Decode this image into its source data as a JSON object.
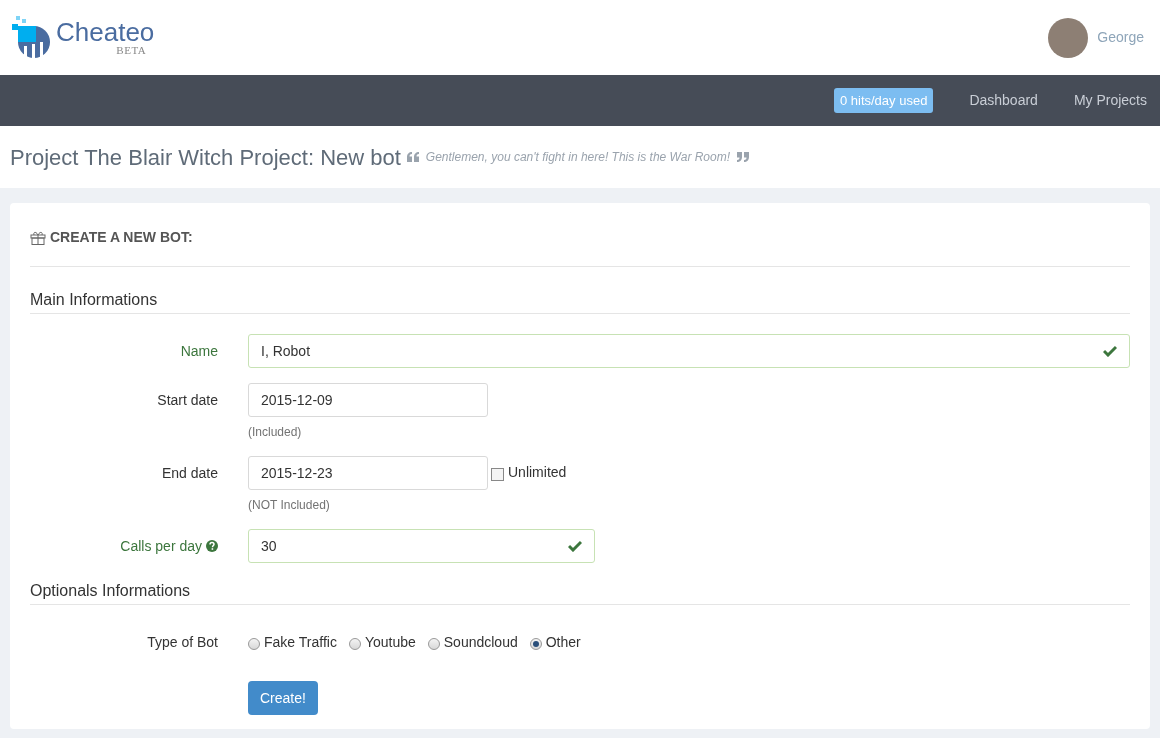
{
  "header": {
    "logo": {
      "name": "Cheateo",
      "tag": "BETA"
    },
    "user": {
      "name": "George"
    }
  },
  "nav": {
    "badge": "0 hits/day used",
    "links": [
      {
        "label": "Dashboard"
      },
      {
        "label": "My Projects"
      }
    ]
  },
  "page": {
    "title": "Project The Blair Witch Project: New bot",
    "quote": "Gentlemen, you can't fight in here! This is the War Room!"
  },
  "card": {
    "title": "CREATE A NEW BOT:",
    "sections": [
      {
        "heading": "Main Informations",
        "fields": [
          {
            "kind": "text",
            "label": "Name",
            "value": "I, Robot",
            "valid": true
          },
          {
            "kind": "date",
            "label": "Start date",
            "value": "2015-12-09",
            "valid": false,
            "help": "(Included)"
          },
          {
            "kind": "date",
            "label": "End date",
            "value": "2015-12-23",
            "valid": false,
            "help": "(NOT Included)",
            "checkbox": {
              "label": "Unlimited",
              "checked": false
            }
          },
          {
            "kind": "number",
            "label": "Calls per day",
            "value": "30",
            "valid": true,
            "info": true
          }
        ]
      },
      {
        "heading": "Optionals Informations",
        "fields": [
          {
            "kind": "radio",
            "label": "Type of Bot",
            "options": [
              {
                "label": "Fake Traffic",
                "selected": false
              },
              {
                "label": "Youtube",
                "selected": false
              },
              {
                "label": "Soundcloud",
                "selected": false
              },
              {
                "label": "Other",
                "selected": true
              }
            ]
          }
        ]
      }
    ],
    "submit": "Create!"
  }
}
